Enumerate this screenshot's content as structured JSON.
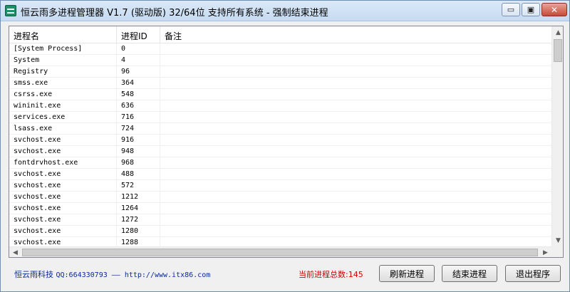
{
  "window": {
    "title": "恒云雨多进程管理器 V1.7 (驱动版) 32/64位 支持所有系统 - 强制结束进程",
    "min_glyph": "▭",
    "max_glyph": "▣",
    "close_glyph": "✕"
  },
  "list": {
    "columns": [
      "进程名",
      "进程ID",
      "备注"
    ],
    "rows": [
      {
        "name": "[System Process]",
        "pid": "0",
        "note": ""
      },
      {
        "name": "System",
        "pid": "4",
        "note": ""
      },
      {
        "name": "Registry",
        "pid": "96",
        "note": ""
      },
      {
        "name": "smss.exe",
        "pid": "364",
        "note": ""
      },
      {
        "name": "csrss.exe",
        "pid": "548",
        "note": ""
      },
      {
        "name": "wininit.exe",
        "pid": "636",
        "note": ""
      },
      {
        "name": "services.exe",
        "pid": "716",
        "note": ""
      },
      {
        "name": "lsass.exe",
        "pid": "724",
        "note": ""
      },
      {
        "name": "svchost.exe",
        "pid": "916",
        "note": ""
      },
      {
        "name": "svchost.exe",
        "pid": "948",
        "note": ""
      },
      {
        "name": "fontdrvhost.exe",
        "pid": "968",
        "note": ""
      },
      {
        "name": "svchost.exe",
        "pid": "488",
        "note": ""
      },
      {
        "name": "svchost.exe",
        "pid": "572",
        "note": ""
      },
      {
        "name": "svchost.exe",
        "pid": "1212",
        "note": ""
      },
      {
        "name": "svchost.exe",
        "pid": "1264",
        "note": ""
      },
      {
        "name": "svchost.exe",
        "pid": "1272",
        "note": ""
      },
      {
        "name": "svchost.exe",
        "pid": "1280",
        "note": ""
      },
      {
        "name": "svchost.exe",
        "pid": "1288",
        "note": ""
      }
    ]
  },
  "footer": {
    "company": "恒云雨科技",
    "contact": "QQ:664330793 —— http://www.itx86.com",
    "total_label": "当前进程总数:145",
    "refresh_label": "刷新进程",
    "kill_label": "结束进程",
    "exit_label": "退出程序"
  },
  "colors": {
    "footer_link": "#0a2a9a",
    "total_text": "#d00000",
    "close_button": "#c74a3a"
  },
  "icons": {
    "app": "app-logo-icon",
    "scroll_up": "scroll-up-arrow-icon",
    "scroll_down": "scroll-down-arrow-icon",
    "scroll_left": "scroll-left-arrow-icon",
    "scroll_right": "scroll-right-arrow-icon"
  }
}
